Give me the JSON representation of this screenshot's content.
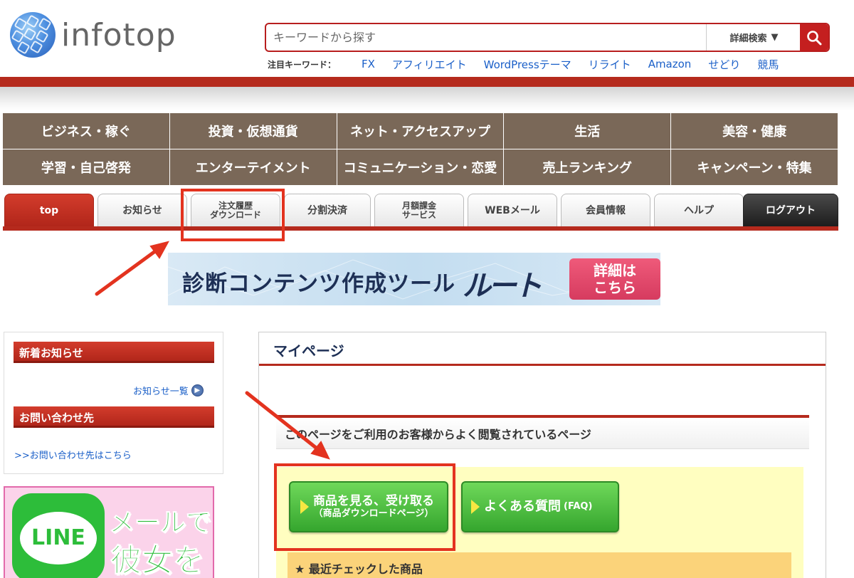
{
  "header": {
    "logo_text": "infotop",
    "search_placeholder": "キーワードから探す",
    "advanced_search_label": "詳細検索",
    "keywords_label": "注目キーワード：",
    "keywords": [
      "FX",
      "アフィリエイト",
      "WordPressテーマ",
      "リライト",
      "Amazon",
      "せどり",
      "競馬"
    ]
  },
  "categories": [
    "ビジネス・稼ぐ",
    "投資・仮想通貨",
    "ネット・アクセスアップ",
    "生活",
    "美容・健康",
    "学習・自己啓発",
    "エンターテイメント",
    "コミュニケーション・恋愛",
    "売上ランキング",
    "キャンペーン・特集"
  ],
  "tabs": {
    "top": "top",
    "news": "お知らせ",
    "order_history_1": "注文履歴",
    "order_history_2": "ダウンロード",
    "split_payment": "分割決済",
    "monthly_1": "月額課金",
    "monthly_2": "サービス",
    "webmail": "WEBメール",
    "member": "会員情報",
    "help": "ヘルプ",
    "logout": "ログアウト"
  },
  "banner": {
    "text": "診断コンテンツ作成ツール",
    "logo": "ルート",
    "button_line1": "詳細は",
    "button_line2": "こちら"
  },
  "sidebar": {
    "news_heading": "新着お知らせ",
    "news_list_link": "お知らせ一覧",
    "contact_heading": "お問い合わせ先",
    "contact_link": ">>お問い合わせ先はこちら"
  },
  "line_ad": {
    "badge": "LINE",
    "line1": "メールで",
    "line2": "彼女を"
  },
  "mypage": {
    "title": "マイページ",
    "frequent_heading": "このページをご利用のお客様からよく閲覧されているページ",
    "btn_products_main": "商品を見る、受け取る",
    "btn_products_sub": "（商品ダウンロードページ）",
    "btn_faq_main": "よくある質問",
    "btn_faq_sub": "(FAQ)",
    "recent_heading": "★ 最近チェックした商品"
  },
  "colors": {
    "brand_red": "#b52a1d",
    "category_brown": "#7a6858",
    "annotation_red": "#e3331f",
    "link_blue": "#1a5fc8"
  }
}
